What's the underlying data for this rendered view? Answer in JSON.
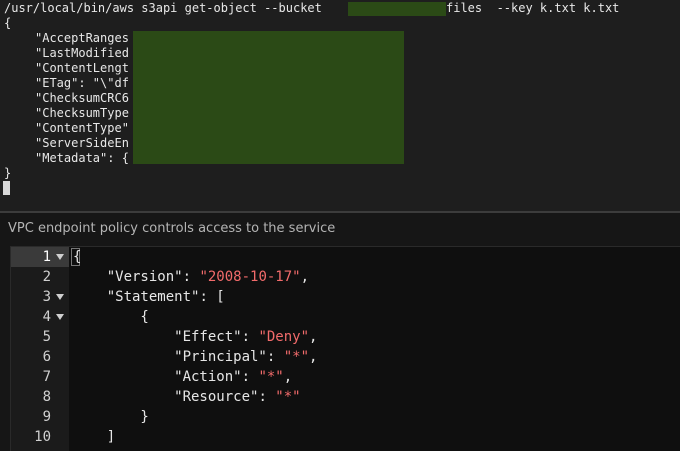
{
  "terminal": {
    "command": "/usr/local/bin/aws s3api get-object --bucket ",
    "command_suffix": "files  --key k.txt k.txt",
    "open_brace": "{",
    "keys": [
      "\"AcceptRanges",
      "\"LastModified",
      "\"ContentLengt",
      "\"ETag\": \"\\\"df",
      "\"ChecksumCRC6",
      "\"ChecksumType",
      "\"ContentType\"",
      "\"ServerSideEn",
      "\"Metadata\": {"
    ],
    "close_brace": "}"
  },
  "panel": {
    "title": "VPC endpoint policy controls access to the service"
  },
  "editor": {
    "lines": [
      {
        "num": "1",
        "text": "{"
      },
      {
        "num": "2",
        "key": "    \"Version\"",
        "sep": ": ",
        "value": "\"2008-10-17\"",
        "tail": ","
      },
      {
        "num": "3",
        "key": "    \"Statement\"",
        "sep": ": [",
        "value": "",
        "tail": ""
      },
      {
        "num": "4",
        "text": "        {"
      },
      {
        "num": "5",
        "key": "            \"Effect\"",
        "sep": ": ",
        "value": "\"Deny\"",
        "tail": ","
      },
      {
        "num": "6",
        "key": "            \"Principal\"",
        "sep": ": ",
        "value": "\"*\"",
        "tail": ","
      },
      {
        "num": "7",
        "key": "            \"Action\"",
        "sep": ": ",
        "value": "\"*\"",
        "tail": ","
      },
      {
        "num": "8",
        "key": "            \"Resource\"",
        "sep": ": ",
        "value": "\"*\"",
        "tail": ""
      },
      {
        "num": "9",
        "text": "        }"
      },
      {
        "num": "10",
        "text": "    ]"
      }
    ]
  },
  "colors": {
    "string": "#f26b6b",
    "redaction": "#2b4a16",
    "terminal_bg": "#1e1e1e"
  }
}
